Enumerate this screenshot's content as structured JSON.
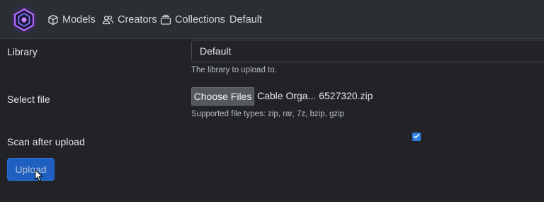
{
  "nav": {
    "items": [
      {
        "label": "Models",
        "icon": "cube-icon"
      },
      {
        "label": "Creators",
        "icon": "users-icon"
      },
      {
        "label": "Collections",
        "icon": "collection-icon"
      },
      {
        "label": "Default",
        "icon": ""
      }
    ],
    "logo": "hexagon-logo"
  },
  "form": {
    "library": {
      "label": "Library",
      "selected": "Default",
      "help": "The library to upload to."
    },
    "file": {
      "label": "Select file",
      "button_label": "Choose Files",
      "file_name": "Cable Orga... 6527320.zip",
      "help": "Supported file types: zip, rar, 7z, bzip, gzip"
    },
    "scan": {
      "label": "Scan after upload",
      "checked": true
    },
    "submit_label": "Upload"
  },
  "colors": {
    "background": "#212327",
    "navbar": "#2b2e33",
    "primary": "#1f5fbf",
    "checkbox": "#2f7de1",
    "logo_accent": "#9b4dff"
  }
}
